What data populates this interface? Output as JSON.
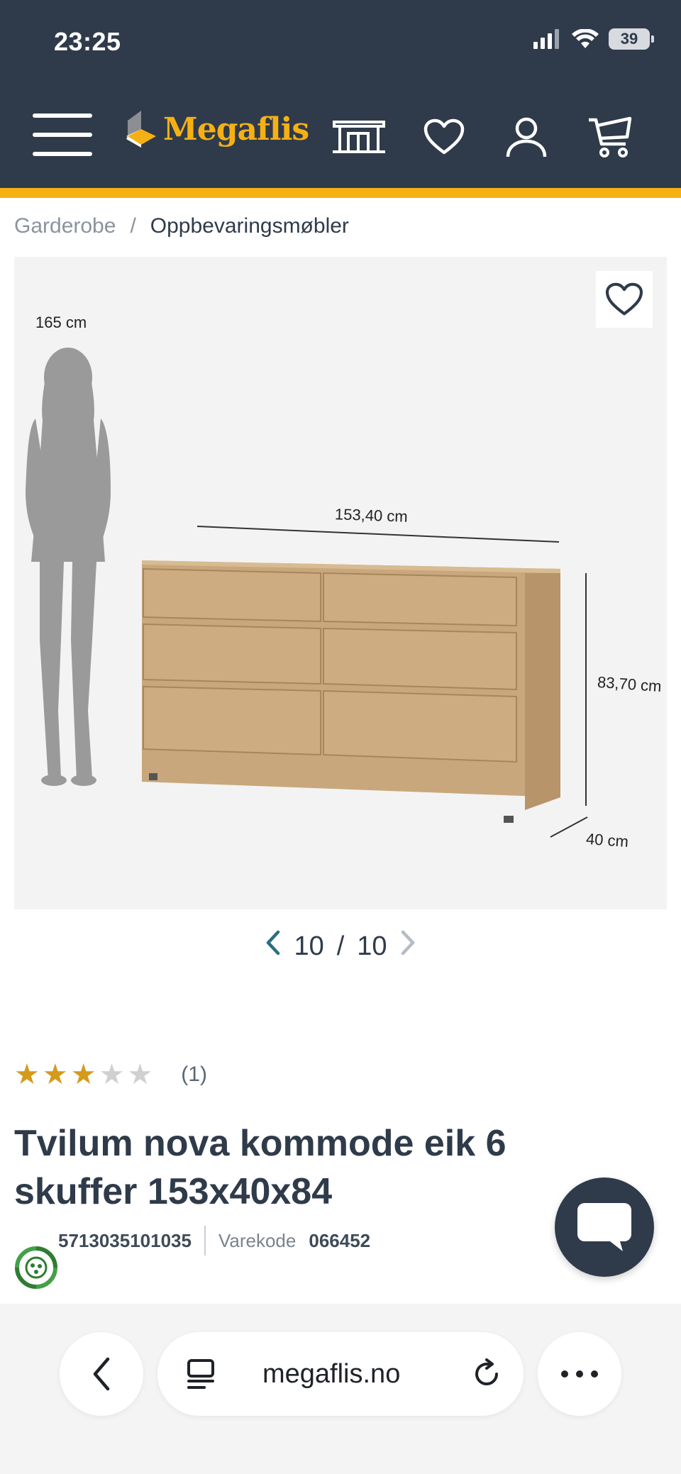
{
  "status_bar": {
    "time": "23:25",
    "battery": "39"
  },
  "header": {
    "logo_text": "Megaflis",
    "icons": [
      "menu-icon",
      "store-icon",
      "heart-icon",
      "user-icon",
      "cart-icon"
    ],
    "brand_color": "#2f3b4a",
    "accent_color": "#f5b014"
  },
  "breadcrumb": {
    "items": [
      "Garderobe",
      "Oppbevaringsmøbler"
    ],
    "separator": "/"
  },
  "gallery": {
    "labels": {
      "person_height": "165 cm",
      "width": "153,40 cm",
      "height": "83,70 cm",
      "depth": "40 cm"
    },
    "current": "10",
    "separator": "/",
    "total": "10"
  },
  "product": {
    "rating": 3,
    "rating_max": 5,
    "review_count": "(1)",
    "title": "Tvilum nova kommode eik 6 skuffer 153x40x84",
    "ean": "5713035101035",
    "item_code_label": "Varekode",
    "item_code": "066452"
  },
  "browser": {
    "url": "megaflis.no"
  }
}
